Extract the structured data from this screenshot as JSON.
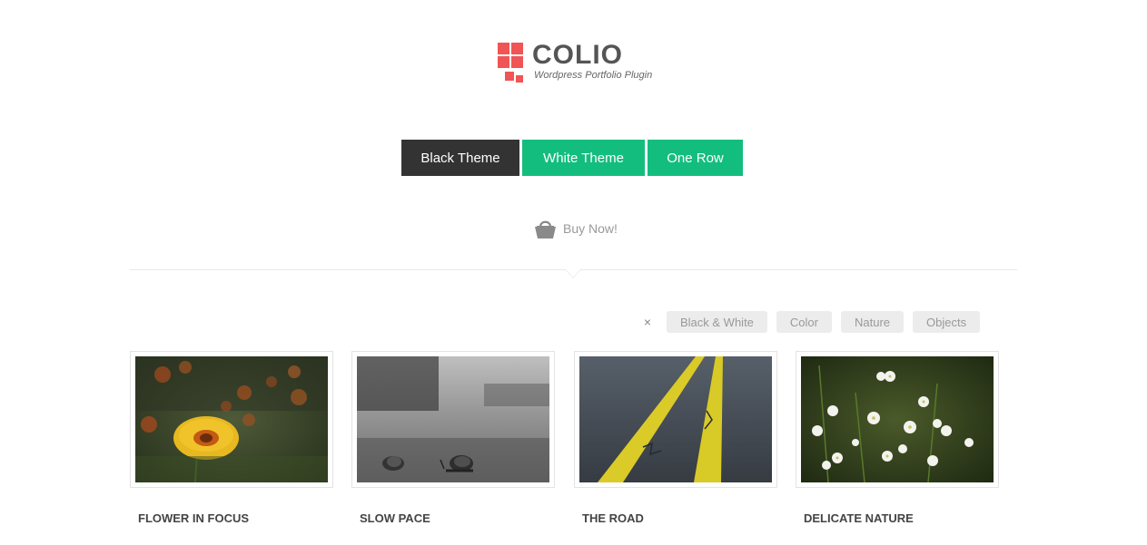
{
  "logo": {
    "title": "COLIO",
    "subtitle": "Wordpress Portfolio Plugin",
    "accent_color": "#f05454"
  },
  "theme_buttons": [
    {
      "label": "Black Theme",
      "color": "#333333"
    },
    {
      "label": "White Theme",
      "color": "#13bd7e"
    },
    {
      "label": "One Row",
      "color": "#13bd7e"
    }
  ],
  "buy_now": {
    "label": "Buy Now!",
    "icon": "shopping-basket-icon"
  },
  "filters": {
    "close_label": "×",
    "tags": [
      "Black & White",
      "Color",
      "Nature",
      "Objects"
    ]
  },
  "portfolio": [
    {
      "title": "FLOWER IN FOCUS",
      "image": "yellow-flower-photo"
    },
    {
      "title": "SLOW PACE",
      "image": "snails-bw-photo"
    },
    {
      "title": "THE ROAD",
      "image": "road-lines-photo"
    },
    {
      "title": "DELICATE NATURE",
      "image": "white-flowers-photo"
    }
  ]
}
